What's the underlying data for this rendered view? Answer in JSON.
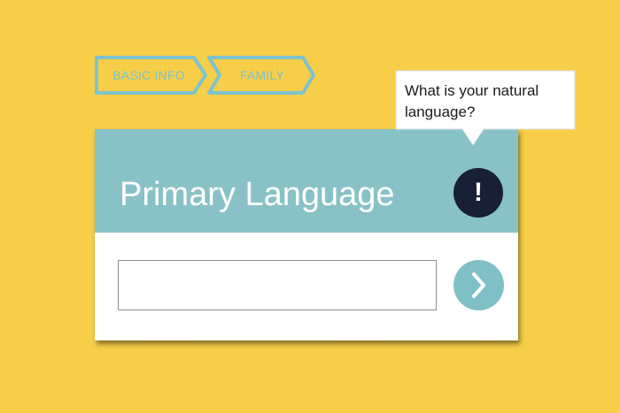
{
  "breadcrumb": {
    "steps": [
      {
        "label": "BASIC INFO"
      },
      {
        "label": "FAMILY"
      }
    ]
  },
  "card": {
    "title": "Primary Language",
    "info_button_glyph": "!",
    "input": {
      "value": "",
      "placeholder": ""
    },
    "next_button_icon": "chevron-right-icon"
  },
  "tooltip": {
    "text": "What is your natural language?"
  },
  "colors": {
    "background": "#f7cd45",
    "accent": "#88c2c6",
    "info_button": "#172034",
    "breadcrumb_outline": "#7cc3cd"
  }
}
